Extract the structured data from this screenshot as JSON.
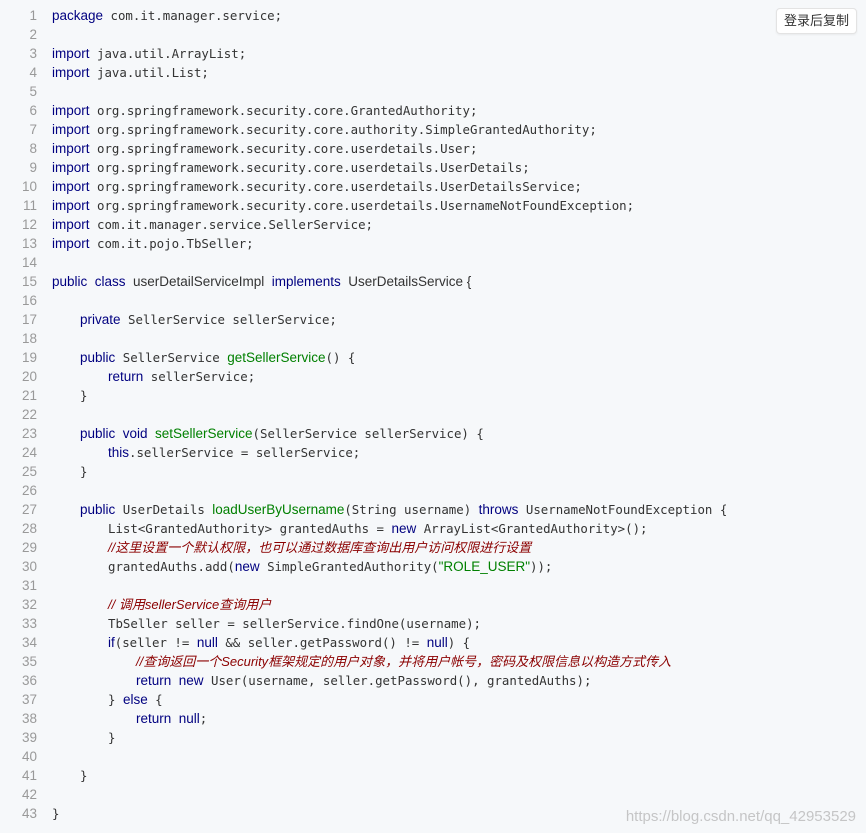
{
  "copy_button": {
    "label": "登录后复制"
  },
  "watermark": "https://blog.csdn.net/qq_42953529",
  "code": {
    "lines": [
      {
        "n": "1",
        "tokens": [
          [
            "kw",
            "package"
          ],
          [
            "",
            "com.it.manager.service;"
          ]
        ]
      },
      {
        "n": "2",
        "tokens": []
      },
      {
        "n": "3",
        "tokens": [
          [
            "kw",
            "import"
          ],
          [
            "",
            "java.util.ArrayList;"
          ]
        ]
      },
      {
        "n": "4",
        "tokens": [
          [
            "kw",
            "import"
          ],
          [
            "",
            "java.util.List;"
          ]
        ]
      },
      {
        "n": "5",
        "tokens": []
      },
      {
        "n": "6",
        "tokens": [
          [
            "kw",
            "import"
          ],
          [
            "",
            "org.springframework.security.core.GrantedAuthority;"
          ]
        ]
      },
      {
        "n": "7",
        "tokens": [
          [
            "kw",
            "import"
          ],
          [
            "",
            "org.springframework.security.core.authority.SimpleGrantedAuthority;"
          ]
        ]
      },
      {
        "n": "8",
        "tokens": [
          [
            "kw",
            "import"
          ],
          [
            "",
            "org.springframework.security.core.userdetails.User;"
          ]
        ]
      },
      {
        "n": "9",
        "tokens": [
          [
            "kw",
            "import"
          ],
          [
            "",
            "org.springframework.security.core.userdetails.UserDetails;"
          ]
        ]
      },
      {
        "n": "10",
        "tokens": [
          [
            "kw",
            "import"
          ],
          [
            "",
            "org.springframework.security.core.userdetails.UserDetailsService;"
          ]
        ]
      },
      {
        "n": "11",
        "tokens": [
          [
            "kw",
            "import"
          ],
          [
            "",
            "org.springframework.security.core.userdetails.UsernameNotFoundException;"
          ]
        ]
      },
      {
        "n": "12",
        "tokens": [
          [
            "kw",
            "import"
          ],
          [
            "",
            "com.it.manager.service.SellerService;"
          ]
        ]
      },
      {
        "n": "13",
        "tokens": [
          [
            "kw",
            "import"
          ],
          [
            "",
            "com.it.pojo.TbSeller;"
          ]
        ]
      },
      {
        "n": "14",
        "tokens": []
      },
      {
        "n": "15",
        "tokens": [
          [
            "kw",
            "public"
          ],
          [
            "kw",
            "class"
          ],
          [
            "cls",
            "userDetailServiceImpl"
          ],
          [
            "kw",
            "implements"
          ],
          [
            "cls",
            "UserDetailsService {"
          ]
        ]
      },
      {
        "n": "16",
        "tokens": []
      },
      {
        "n": "17",
        "indent": 1,
        "tokens": [
          [
            "kw",
            "private"
          ],
          [
            "",
            "SellerService sellerService;"
          ]
        ]
      },
      {
        "n": "18",
        "tokens": []
      },
      {
        "n": "19",
        "indent": 1,
        "tokens": [
          [
            "kw",
            "public"
          ],
          [
            "",
            "SellerService"
          ],
          [
            "fn",
            "getSellerService"
          ],
          [
            "",
            "() {"
          ]
        ]
      },
      {
        "n": "20",
        "indent": 2,
        "tokens": [
          [
            "kw",
            "return"
          ],
          [
            "",
            "sellerService;"
          ]
        ]
      },
      {
        "n": "21",
        "indent": 1,
        "tokens": [
          [
            "",
            "}"
          ]
        ]
      },
      {
        "n": "22",
        "tokens": []
      },
      {
        "n": "23",
        "indent": 1,
        "tokens": [
          [
            "kw",
            "public"
          ],
          [
            "kw",
            "void"
          ],
          [
            "fn",
            "setSellerService"
          ],
          [
            "",
            "(SellerService sellerService) {"
          ]
        ]
      },
      {
        "n": "24",
        "indent": 2,
        "tokens": [
          [
            "kw",
            "this"
          ],
          [
            "",
            ".sellerService = sellerService;"
          ]
        ]
      },
      {
        "n": "25",
        "indent": 1,
        "tokens": [
          [
            "",
            "}"
          ]
        ]
      },
      {
        "n": "26",
        "tokens": []
      },
      {
        "n": "27",
        "indent": 1,
        "tokens": [
          [
            "kw",
            "public"
          ],
          [
            "",
            "UserDetails"
          ],
          [
            "fn",
            "loadUserByUsername"
          ],
          [
            "",
            "(String username)"
          ],
          [
            "kw",
            "throws"
          ],
          [
            "",
            "UsernameNotFoundException {"
          ]
        ]
      },
      {
        "n": "28",
        "indent": 2,
        "tokens": [
          [
            "",
            "List<GrantedAuthority> grantedAuths ="
          ],
          [
            "kw",
            "new"
          ],
          [
            "",
            "ArrayList<GrantedAuthority>();"
          ]
        ]
      },
      {
        "n": "29",
        "indent": 2,
        "tokens": [
          [
            "cm",
            "//这里设置一个默认权限，也可以通过数据库查询出用户访问权限进行设置"
          ]
        ]
      },
      {
        "n": "30",
        "indent": 2,
        "tokens": [
          [
            "",
            "grantedAuths.add("
          ],
          [
            "kw",
            "new"
          ],
          [
            "",
            "SimpleGrantedAuthority("
          ],
          [
            "str",
            "\"ROLE_USER\""
          ],
          [
            "",
            "));"
          ]
        ]
      },
      {
        "n": "31",
        "tokens": []
      },
      {
        "n": "32",
        "indent": 2,
        "tokens": [
          [
            "cm",
            "// 调用sellerService查询用户"
          ]
        ]
      },
      {
        "n": "33",
        "indent": 2,
        "tokens": [
          [
            "",
            "TbSeller seller = sellerService.findOne(username);"
          ]
        ]
      },
      {
        "n": "34",
        "indent": 2,
        "tokens": [
          [
            "kw",
            "if"
          ],
          [
            "",
            "(seller !="
          ],
          [
            "kw",
            "null"
          ],
          [
            "",
            "&& seller.getPassword() !="
          ],
          [
            "kw",
            "null"
          ],
          [
            "",
            ") {"
          ]
        ]
      },
      {
        "n": "35",
        "indent": 3,
        "tokens": [
          [
            "cm",
            "//查询返回一个Security框架规定的用户对象，并将用户帐号，密码及权限信息以构造方式传入"
          ]
        ]
      },
      {
        "n": "36",
        "indent": 3,
        "tokens": [
          [
            "kw",
            "return"
          ],
          [
            "kw",
            "new"
          ],
          [
            "",
            "User(username, seller.getPassword(), grantedAuths);"
          ]
        ]
      },
      {
        "n": "37",
        "indent": 2,
        "tokens": [
          [
            "",
            "}"
          ],
          [
            "kw",
            "else"
          ],
          [
            "",
            "{"
          ]
        ]
      },
      {
        "n": "38",
        "indent": 3,
        "tokens": [
          [
            "kw",
            "return"
          ],
          [
            "kw",
            "null"
          ],
          [
            "",
            ";"
          ]
        ]
      },
      {
        "n": "39",
        "indent": 2,
        "tokens": [
          [
            "",
            "}"
          ]
        ]
      },
      {
        "n": "40",
        "tokens": []
      },
      {
        "n": "41",
        "indent": 1,
        "tokens": [
          [
            "",
            "}"
          ]
        ]
      },
      {
        "n": "42",
        "tokens": []
      },
      {
        "n": "43",
        "tokens": [
          [
            "",
            "}"
          ]
        ]
      }
    ]
  }
}
